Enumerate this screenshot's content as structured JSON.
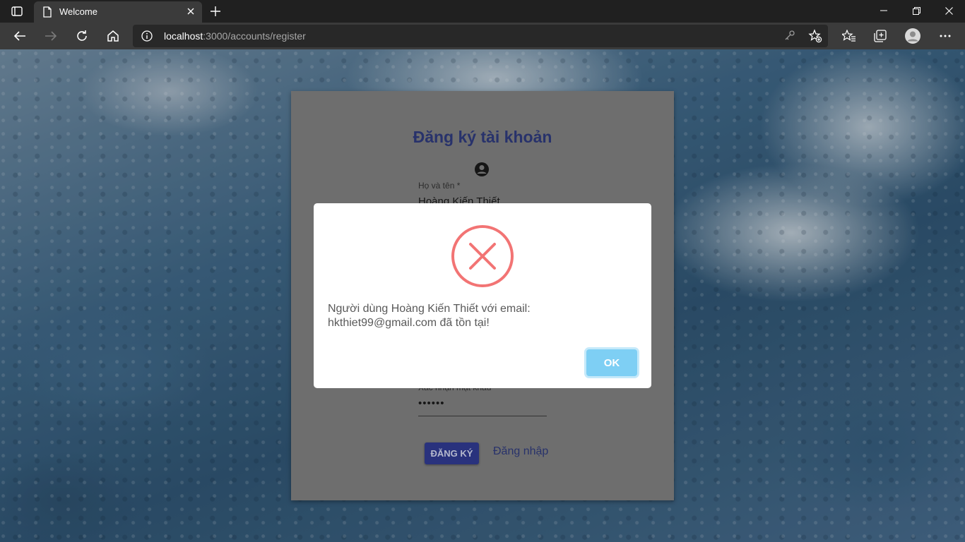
{
  "browser": {
    "tab": {
      "title": "Welcome"
    },
    "address": {
      "host": "localhost",
      "path": ":3000/accounts/register"
    }
  },
  "form": {
    "title": "Đăng ký tài khoản",
    "name_label": "Họ và tên *",
    "name_value": "Hoàng Kiến Thiết",
    "confirm_label": "Xác nhận mật khẩu",
    "confirm_value": "••••••",
    "register_label": "ĐĂNG KÝ",
    "login_link": "Đăng nhập"
  },
  "dialog": {
    "message_line1": "Người dùng Hoàng Kiến Thiết với email:",
    "message_line2": "hkthiet99@gmail.com đã tồn tại!",
    "ok_label": "OK",
    "icon": "error-x-icon"
  },
  "colors": {
    "primary": "#2f3a8f",
    "error": "#f27474",
    "ok_button": "#7ecff4"
  }
}
